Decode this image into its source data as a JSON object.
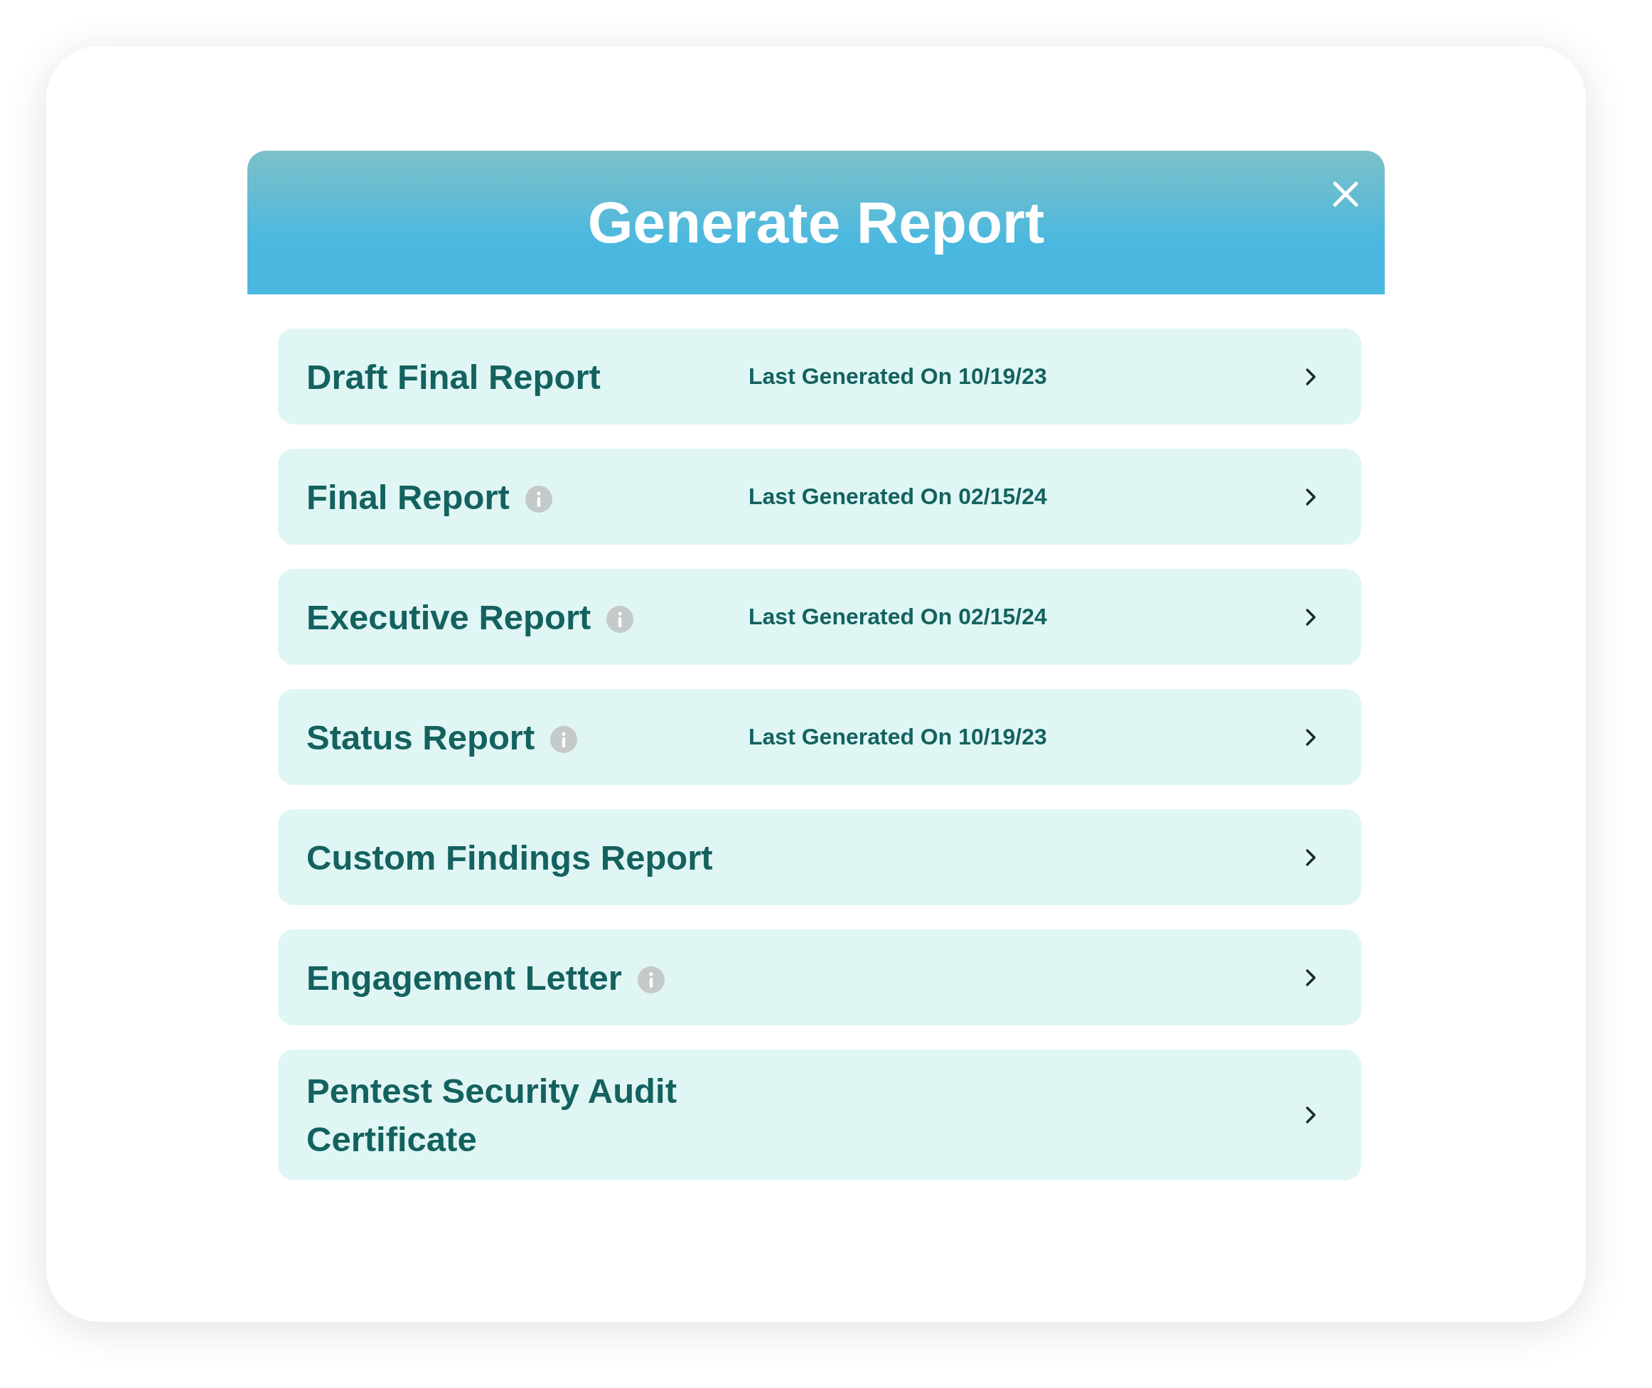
{
  "dialog": {
    "title": "Generate Report"
  },
  "reports": [
    {
      "name": "Draft Final Report",
      "info_icon": false,
      "last_generated": "Last Generated On 10/19/23"
    },
    {
      "name": "Final Report",
      "info_icon": true,
      "last_generated": "Last Generated On 02/15/24"
    },
    {
      "name": "Executive Report",
      "info_icon": true,
      "last_generated": "Last Generated On 02/15/24"
    },
    {
      "name": "Status Report",
      "info_icon": true,
      "last_generated": "Last Generated On 10/19/23"
    },
    {
      "name": "Custom Findings Report",
      "info_icon": false
    },
    {
      "name": "Engagement Letter",
      "info_icon": true
    },
    {
      "name": "Pentest Security Audit Certificate",
      "info_icon": false
    }
  ]
}
